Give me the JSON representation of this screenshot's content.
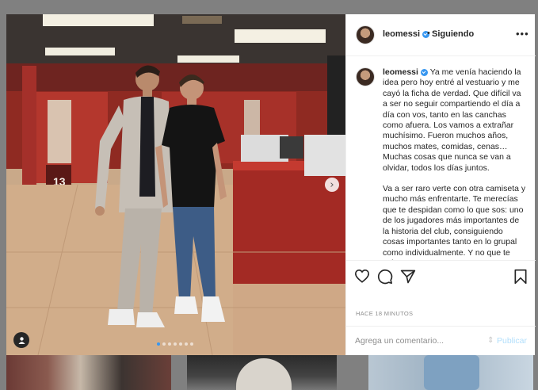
{
  "post": {
    "username": "leomessi",
    "separator": "•",
    "follow_state": "Siguiendo",
    "more_icon": "more-horizontal-icon",
    "caption_username": "leomessi",
    "caption_paragraph_1": "Ya me venía haciendo la idea pero hoy entré al vestuario y me cayó la ficha de verdad. Que difícil va a ser no seguir compartiendo el día a día con vos, tanto en las canchas como afuera. Los vamos a extrañar muchísimo. Fueron muchos años, muchos mates, comidas, cenas… Muchas cosas que nunca se van a olvidar, todos los días juntos.",
    "caption_paragraph_2": "Va a ser raro verte con otra camiseta y mucho más enfrentarte. Te merecías que te despidan como lo que sos: uno de los jugadores más importantes de la historia del club, consiguiendo cosas importantes tanto en lo grupal como individualmente. Y no que te echen",
    "timestamp": "HACE 18 MINUTOS",
    "comment_placeholder": "Agrega un comentario...",
    "publish_label": "Publicar",
    "photo_locker_number": "13",
    "carousel_total": 7,
    "carousel_active": 1
  },
  "colors": {
    "accent": "#3897f0",
    "text": "#262626",
    "muted": "#8e8e8e",
    "publish_disabled": "#b2dffc",
    "backdrop": "#808080"
  }
}
